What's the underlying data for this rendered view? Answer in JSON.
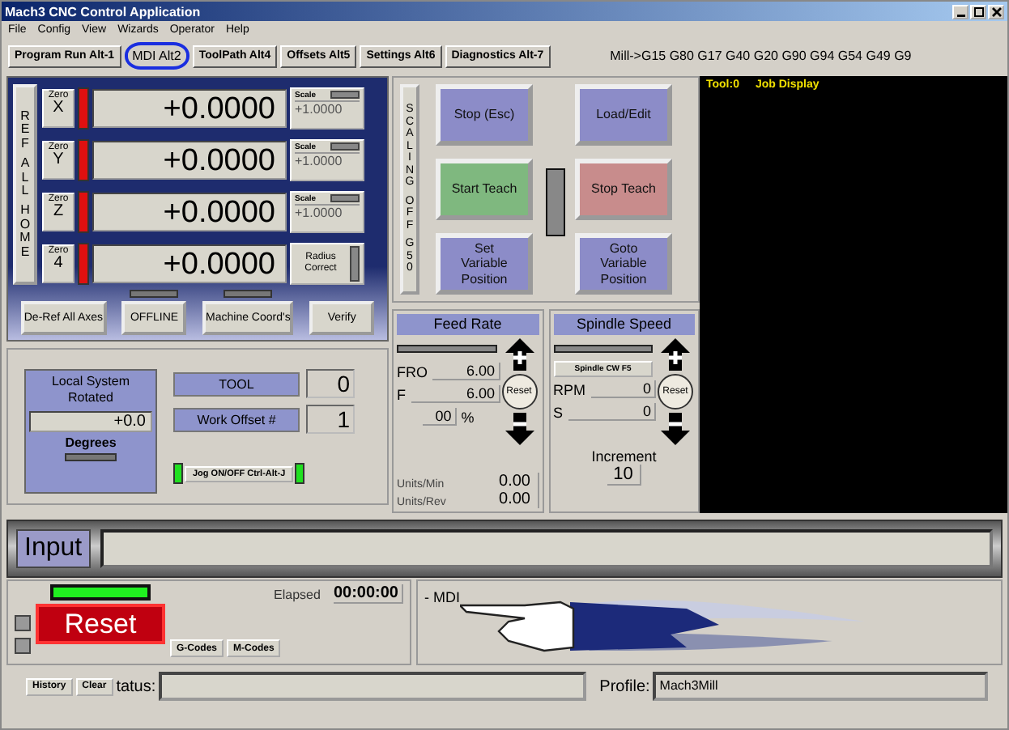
{
  "window": {
    "title": "Mach3 CNC Control Application"
  },
  "menu": [
    "File",
    "Config",
    "View",
    "Wizards",
    "Operator",
    "Help"
  ],
  "tabs": [
    {
      "label": "Program Run Alt-1",
      "selected": false
    },
    {
      "label": "MDI Alt2",
      "selected": true
    },
    {
      "label": "ToolPath Alt4",
      "selected": false
    },
    {
      "label": "Offsets Alt5",
      "selected": false
    },
    {
      "label": "Settings Alt6",
      "selected": false
    },
    {
      "label": "Diagnostics Alt-7",
      "selected": false
    }
  ],
  "modal_codes": "Mill->G15  G80 G17 G40 G20 G90 G94 G54 G49 G9",
  "ref_all_home": "REF ALL HOME",
  "axes": [
    {
      "zero": "Zero",
      "axis": "X",
      "value": "+0.0000",
      "side": {
        "kind": "scale",
        "label": "Scale",
        "value": "+1.0000"
      }
    },
    {
      "zero": "Zero",
      "axis": "Y",
      "value": "+0.0000",
      "side": {
        "kind": "scale",
        "label": "Scale",
        "value": "+1.0000"
      }
    },
    {
      "zero": "Zero",
      "axis": "Z",
      "value": "+0.0000",
      "side": {
        "kind": "scale",
        "label": "Scale",
        "value": "+1.0000"
      }
    },
    {
      "zero": "Zero",
      "axis": "4",
      "value": "+0.0000",
      "side": {
        "kind": "radius",
        "label": "Radius Correct"
      }
    }
  ],
  "dro_buttons": [
    {
      "label": "De-Ref All Axes",
      "led": false
    },
    {
      "label": "OFFLINE",
      "led": true
    },
    {
      "label": "Machine Coord's",
      "led": true
    },
    {
      "label": "Verify",
      "led": false
    }
  ],
  "scaling": "SCALING OFF G50",
  "control_buttons": [
    {
      "label": "Stop (Esc)",
      "color": "#8c8cc8"
    },
    {
      "label": "Load/Edit",
      "color": "#8c8cc8"
    },
    {
      "label": "Start Teach",
      "color": "#7fb87f"
    },
    {
      "label": "Stop Teach",
      "color": "#c88c8c"
    },
    {
      "label": "Set Variable Position",
      "color": "#8c8cc8"
    },
    {
      "label": "Goto Variable Position",
      "color": "#8c8cc8"
    }
  ],
  "local_system": {
    "title": "Local System Rotated",
    "value": "+0.0",
    "unit": "Degrees"
  },
  "tool": {
    "label": "TOOL",
    "value": "0"
  },
  "work_offset": {
    "label": "Work Offset #",
    "value": "1"
  },
  "jog_button": "Jog ON/OFF Ctrl-Alt-J",
  "feed_rate": {
    "title": "Feed Rate",
    "fro_label": "FRO",
    "fro": "6.00",
    "f_label": "F",
    "f": "6.00",
    "percent": "00",
    "percent_sign": "%",
    "reset": "Reset",
    "units_min_label": "Units/Min",
    "units_min": "0.00",
    "units_rev_label": "Units/Rev",
    "units_rev": "0.00"
  },
  "spindle": {
    "title": "Spindle Speed",
    "button": "Spindle CW F5",
    "rpm_label": "RPM",
    "rpm": "0",
    "s_label": "S",
    "s": "0",
    "reset": "Reset",
    "increment_label": "Increment",
    "increment": "10"
  },
  "toolpath": {
    "tool": "Tool:0",
    "title": "Job Display"
  },
  "input": {
    "label": "Input"
  },
  "run": {
    "reset": "Reset",
    "elapsed_label": "Elapsed",
    "elapsed": "00:00:00",
    "buttons": [
      "G-Codes",
      "M-Codes"
    ],
    "mode": "- MDI"
  },
  "status_bar": {
    "buttons": [
      "History",
      "Clear"
    ],
    "status_label": "tatus:",
    "profile_label": "Profile:",
    "profile": "Mach3Mill"
  }
}
